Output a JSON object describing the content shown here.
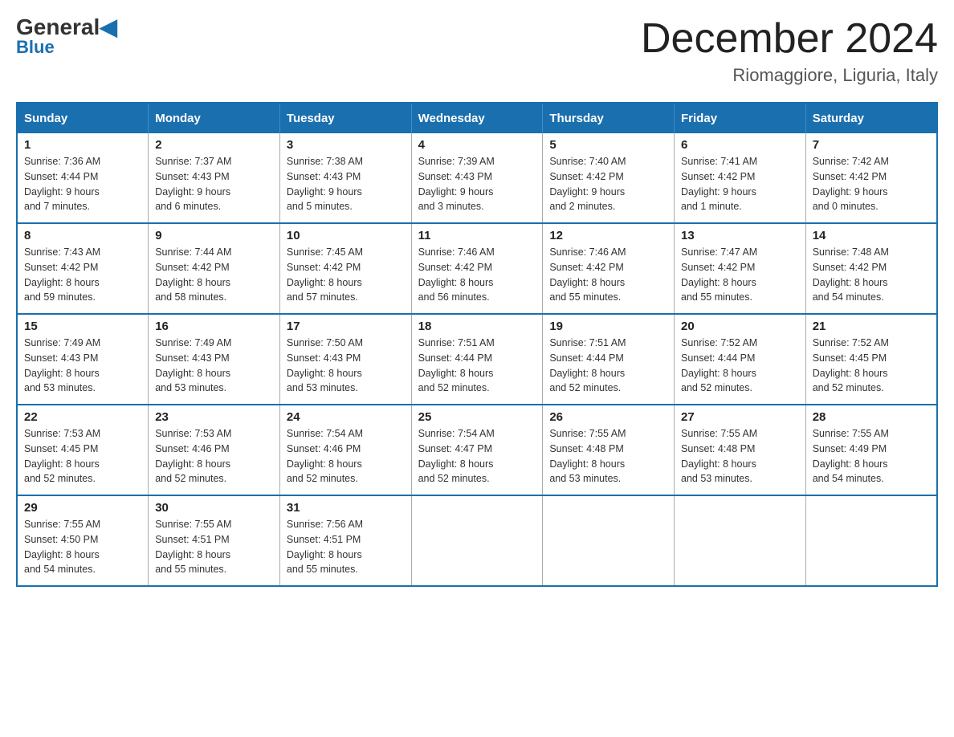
{
  "header": {
    "logo_main": "General",
    "logo_sub": "Blue",
    "title": "December 2024",
    "subtitle": "Riomaggiore, Liguria, Italy"
  },
  "days_of_week": [
    "Sunday",
    "Monday",
    "Tuesday",
    "Wednesday",
    "Thursday",
    "Friday",
    "Saturday"
  ],
  "weeks": [
    [
      {
        "day": "1",
        "sunrise": "7:36 AM",
        "sunset": "4:44 PM",
        "daylight": "9 hours and 7 minutes."
      },
      {
        "day": "2",
        "sunrise": "7:37 AM",
        "sunset": "4:43 PM",
        "daylight": "9 hours and 6 minutes."
      },
      {
        "day": "3",
        "sunrise": "7:38 AM",
        "sunset": "4:43 PM",
        "daylight": "9 hours and 5 minutes."
      },
      {
        "day": "4",
        "sunrise": "7:39 AM",
        "sunset": "4:43 PM",
        "daylight": "9 hours and 3 minutes."
      },
      {
        "day": "5",
        "sunrise": "7:40 AM",
        "sunset": "4:42 PM",
        "daylight": "9 hours and 2 minutes."
      },
      {
        "day": "6",
        "sunrise": "7:41 AM",
        "sunset": "4:42 PM",
        "daylight": "9 hours and 1 minute."
      },
      {
        "day": "7",
        "sunrise": "7:42 AM",
        "sunset": "4:42 PM",
        "daylight": "9 hours and 0 minutes."
      }
    ],
    [
      {
        "day": "8",
        "sunrise": "7:43 AM",
        "sunset": "4:42 PM",
        "daylight": "8 hours and 59 minutes."
      },
      {
        "day": "9",
        "sunrise": "7:44 AM",
        "sunset": "4:42 PM",
        "daylight": "8 hours and 58 minutes."
      },
      {
        "day": "10",
        "sunrise": "7:45 AM",
        "sunset": "4:42 PM",
        "daylight": "8 hours and 57 minutes."
      },
      {
        "day": "11",
        "sunrise": "7:46 AM",
        "sunset": "4:42 PM",
        "daylight": "8 hours and 56 minutes."
      },
      {
        "day": "12",
        "sunrise": "7:46 AM",
        "sunset": "4:42 PM",
        "daylight": "8 hours and 55 minutes."
      },
      {
        "day": "13",
        "sunrise": "7:47 AM",
        "sunset": "4:42 PM",
        "daylight": "8 hours and 55 minutes."
      },
      {
        "day": "14",
        "sunrise": "7:48 AM",
        "sunset": "4:42 PM",
        "daylight": "8 hours and 54 minutes."
      }
    ],
    [
      {
        "day": "15",
        "sunrise": "7:49 AM",
        "sunset": "4:43 PM",
        "daylight": "8 hours and 53 minutes."
      },
      {
        "day": "16",
        "sunrise": "7:49 AM",
        "sunset": "4:43 PM",
        "daylight": "8 hours and 53 minutes."
      },
      {
        "day": "17",
        "sunrise": "7:50 AM",
        "sunset": "4:43 PM",
        "daylight": "8 hours and 53 minutes."
      },
      {
        "day": "18",
        "sunrise": "7:51 AM",
        "sunset": "4:44 PM",
        "daylight": "8 hours and 52 minutes."
      },
      {
        "day": "19",
        "sunrise": "7:51 AM",
        "sunset": "4:44 PM",
        "daylight": "8 hours and 52 minutes."
      },
      {
        "day": "20",
        "sunrise": "7:52 AM",
        "sunset": "4:44 PM",
        "daylight": "8 hours and 52 minutes."
      },
      {
        "day": "21",
        "sunrise": "7:52 AM",
        "sunset": "4:45 PM",
        "daylight": "8 hours and 52 minutes."
      }
    ],
    [
      {
        "day": "22",
        "sunrise": "7:53 AM",
        "sunset": "4:45 PM",
        "daylight": "8 hours and 52 minutes."
      },
      {
        "day": "23",
        "sunrise": "7:53 AM",
        "sunset": "4:46 PM",
        "daylight": "8 hours and 52 minutes."
      },
      {
        "day": "24",
        "sunrise": "7:54 AM",
        "sunset": "4:46 PM",
        "daylight": "8 hours and 52 minutes."
      },
      {
        "day": "25",
        "sunrise": "7:54 AM",
        "sunset": "4:47 PM",
        "daylight": "8 hours and 52 minutes."
      },
      {
        "day": "26",
        "sunrise": "7:55 AM",
        "sunset": "4:48 PM",
        "daylight": "8 hours and 53 minutes."
      },
      {
        "day": "27",
        "sunrise": "7:55 AM",
        "sunset": "4:48 PM",
        "daylight": "8 hours and 53 minutes."
      },
      {
        "day": "28",
        "sunrise": "7:55 AM",
        "sunset": "4:49 PM",
        "daylight": "8 hours and 54 minutes."
      }
    ],
    [
      {
        "day": "29",
        "sunrise": "7:55 AM",
        "sunset": "4:50 PM",
        "daylight": "8 hours and 54 minutes."
      },
      {
        "day": "30",
        "sunrise": "7:55 AM",
        "sunset": "4:51 PM",
        "daylight": "8 hours and 55 minutes."
      },
      {
        "day": "31",
        "sunrise": "7:56 AM",
        "sunset": "4:51 PM",
        "daylight": "8 hours and 55 minutes."
      },
      null,
      null,
      null,
      null
    ]
  ],
  "labels": {
    "sunrise": "Sunrise:",
    "sunset": "Sunset:",
    "daylight": "Daylight:"
  }
}
